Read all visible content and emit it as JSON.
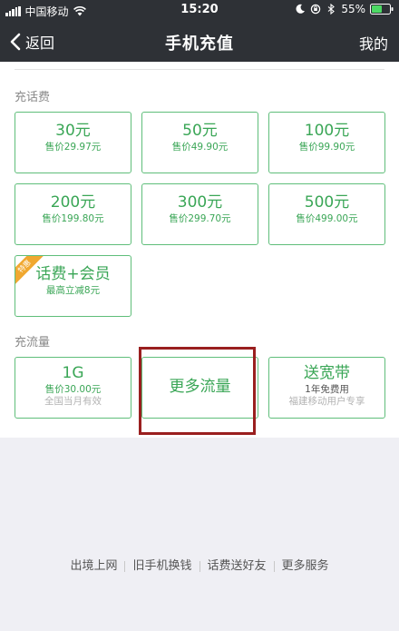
{
  "status_bar": {
    "carrier": "中国移动",
    "time": "15:20",
    "battery": "55%"
  },
  "nav": {
    "back_label": "返回",
    "title": "手机充值",
    "right_label": "我的"
  },
  "section_phone": {
    "label": "充话费",
    "cards": [
      {
        "amount": "30元",
        "price": "售价29.97元"
      },
      {
        "amount": "50元",
        "price": "售价49.90元"
      },
      {
        "amount": "100元",
        "price": "售价99.90元"
      },
      {
        "amount": "200元",
        "price": "售价199.80元"
      },
      {
        "amount": "300元",
        "price": "售价299.70元"
      },
      {
        "amount": "500元",
        "price": "售价499.00元"
      }
    ],
    "special": {
      "badge": "特惠",
      "title": "话费+会员",
      "desc": "最高立减8元"
    }
  },
  "section_data": {
    "label": "充流量",
    "card_1g": {
      "amount": "1G",
      "price": "售价30.00元",
      "note": "全国当月有效"
    },
    "more": {
      "label": "更多流量"
    },
    "broadband": {
      "title": "送宽带",
      "desc": "1年免费用",
      "note": "福建移动用户专享"
    }
  },
  "footer": {
    "links": [
      "出境上网",
      "旧手机换钱",
      "话费送好友",
      "更多服务"
    ]
  },
  "colors": {
    "accent": "#3aa656",
    "nav_bg": "#2e3136",
    "highlight": "#9a1f1f",
    "badge": "#f0a830"
  }
}
